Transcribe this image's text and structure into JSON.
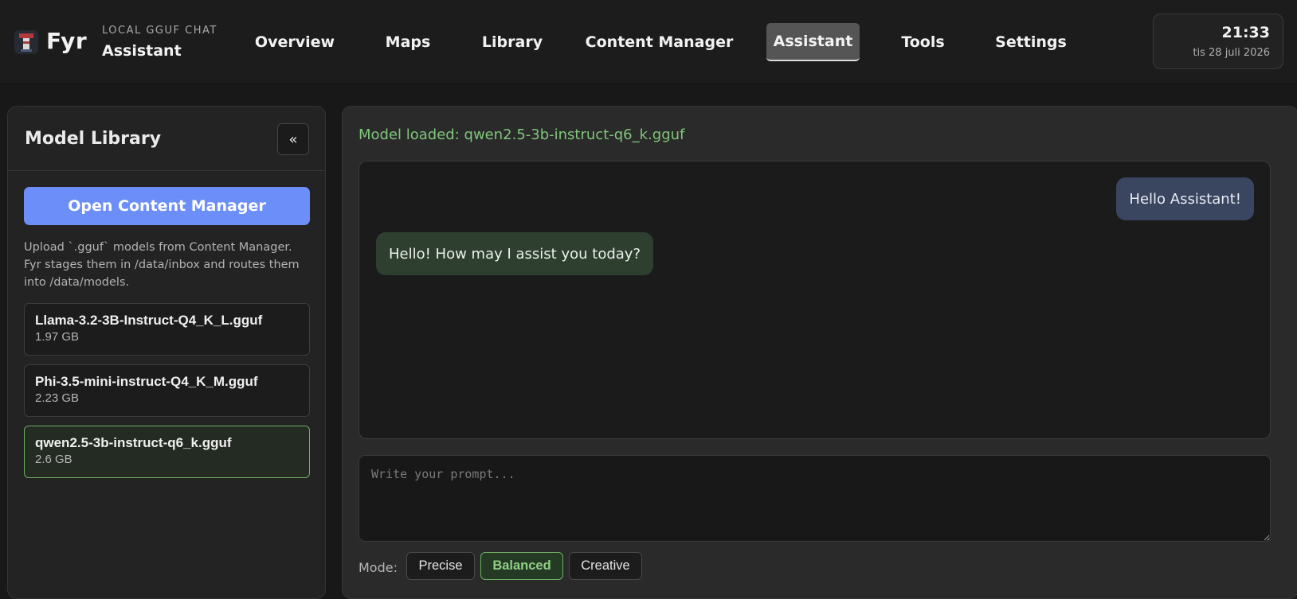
{
  "header": {
    "brand": "Fyr",
    "subtitle": "LOCAL GGUF CHAT",
    "page_title": "Assistant",
    "nav_tabs": [
      {
        "label": "Overview",
        "active": false
      },
      {
        "label": "Maps",
        "active": false
      },
      {
        "label": "Library",
        "active": false
      },
      {
        "label": "Content Manager",
        "active": false
      },
      {
        "label": "Assistant",
        "active": true
      },
      {
        "label": "Tools",
        "active": false
      },
      {
        "label": "Settings",
        "active": false
      }
    ],
    "clock": {
      "time": "21:33",
      "date": "tis 28 juli 2026"
    }
  },
  "sidebar": {
    "title": "Model Library",
    "collapse_label": "«",
    "open_content_manager_label": "Open Content Manager",
    "help_text": "Upload `.gguf` models from Content Manager. Fyr stages them in /data/inbox and routes them into /data/models.",
    "models": [
      {
        "name": "Llama-3.2-3B-Instruct-Q4_K_L.gguf",
        "size": "1.97 GB",
        "selected": false
      },
      {
        "name": "Phi-3.5-mini-instruct-Q4_K_M.gguf",
        "size": "2.23 GB",
        "selected": false
      },
      {
        "name": "qwen2.5-3b-instruct-q6_k.gguf",
        "size": "2.6 GB",
        "selected": true
      }
    ]
  },
  "main": {
    "status": "Model loaded: qwen2.5-3b-instruct-q6_k.gguf",
    "messages": [
      {
        "role": "user",
        "text": "Hello Assistant!"
      },
      {
        "role": "assistant",
        "text": "Hello! How may I assist you today?"
      }
    ],
    "prompt": {
      "placeholder": "Write your prompt...",
      "value": ""
    },
    "mode_label": "Mode:",
    "modes": [
      {
        "label": "Precise",
        "active": false
      },
      {
        "label": "Balanced",
        "active": true
      },
      {
        "label": "Creative",
        "active": false
      }
    ]
  },
  "colors": {
    "accent_blue": "#6b8ef8",
    "success_green": "#7fc77a",
    "user_bubble": "#3a465f",
    "assistant_bubble": "#2e3f30"
  }
}
